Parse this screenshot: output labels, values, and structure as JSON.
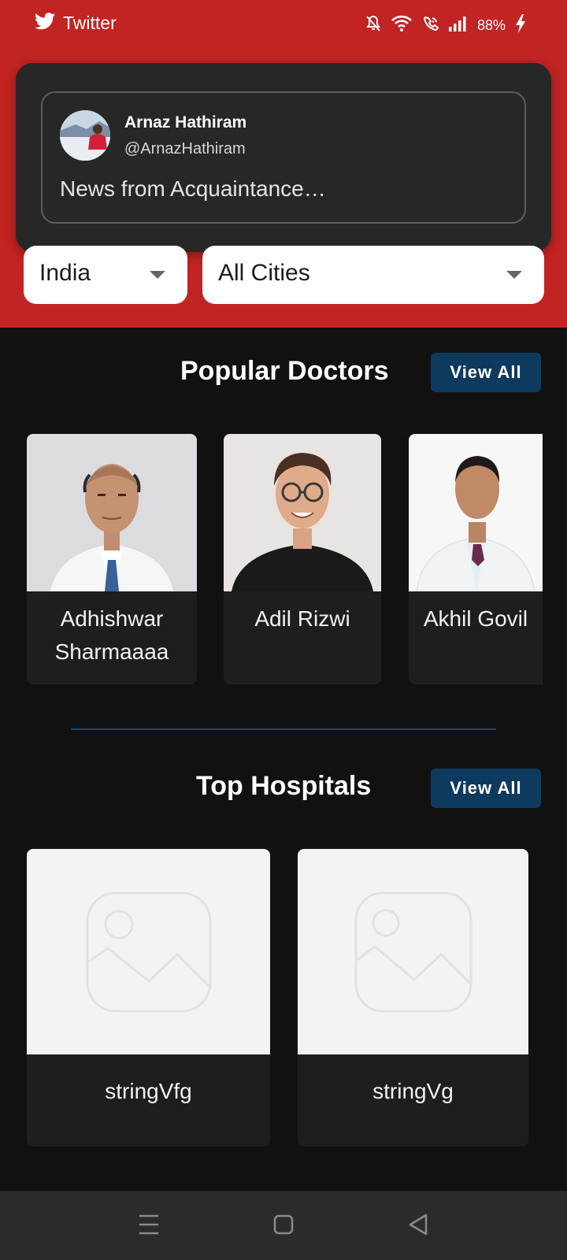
{
  "status_bar": {
    "app_name": "Twitter",
    "battery": "88%"
  },
  "notification": {
    "name": "Arnaz Hathiram",
    "handle": "@ArnazHathiram",
    "text": "News from Acquaintance…"
  },
  "filters": {
    "country": "India",
    "city": "All Cities"
  },
  "doctors": {
    "title": "Popular Doctors",
    "view_all": "View All",
    "items": [
      {
        "name": "Adhishwar Sharmaaaa"
      },
      {
        "name": "Adil Rizwi"
      },
      {
        "name": "Akhil Govil"
      }
    ]
  },
  "hospitals": {
    "title": "Top Hospitals",
    "view_all": "View All",
    "items": [
      {
        "name": "stringVfg"
      },
      {
        "name": "stringVg"
      }
    ]
  },
  "colors": {
    "header_red": "#c22423",
    "button_blue": "#0e3a5f",
    "background": "#111111"
  }
}
